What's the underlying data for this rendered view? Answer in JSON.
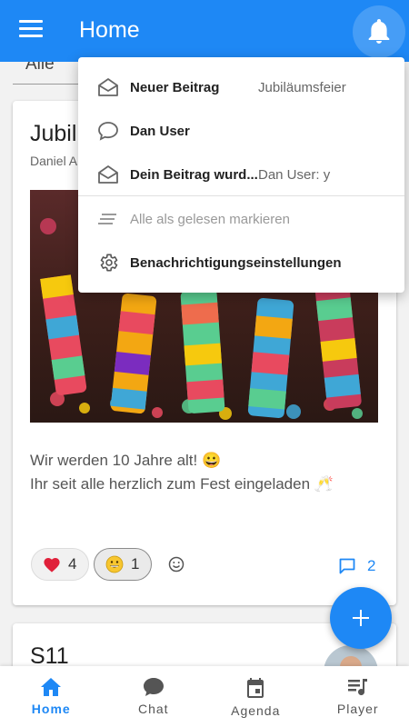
{
  "app_bar": {
    "title": "Home",
    "color": "#1e88f5"
  },
  "filter": {
    "selected": "Alle"
  },
  "post": {
    "title": "Jubiläumsfeier",
    "title_visible": "Jubil",
    "author_visible": "Daniel A",
    "text_line1": "Wir werden 10 Jahre alt! 😀",
    "text_line2": "Ihr seit alle herzlich zum Fest eingeladen 🥂",
    "reactions": [
      {
        "emoji": "heart-icon",
        "count": "4"
      },
      {
        "emoji": "grinning-face-icon",
        "count": "1"
      }
    ],
    "comment_count": "2"
  },
  "post2": {
    "title": "S11"
  },
  "notifications": {
    "items": [
      {
        "label": "Neuer Beitrag",
        "sub": "Jubiläumsfeier",
        "icon": "envelope-open-icon"
      },
      {
        "label": "Dan User",
        "sub": "",
        "icon": "chat-bubble-icon"
      },
      {
        "label": "Dein Beitrag wurd...",
        "sub": "Dan User: y",
        "icon": "envelope-open-icon"
      }
    ],
    "mark_all_read": "Alle als gelesen markieren",
    "settings": "Benachrichtigungseinstellungen"
  },
  "bottom_nav": [
    {
      "label": "Home",
      "icon": "home-icon",
      "active": true
    },
    {
      "label": "Chat",
      "icon": "chat-icon",
      "active": false
    },
    {
      "label": "Agenda",
      "icon": "calendar-icon",
      "active": false
    },
    {
      "label": "Player",
      "icon": "playlist-icon",
      "active": false
    }
  ]
}
